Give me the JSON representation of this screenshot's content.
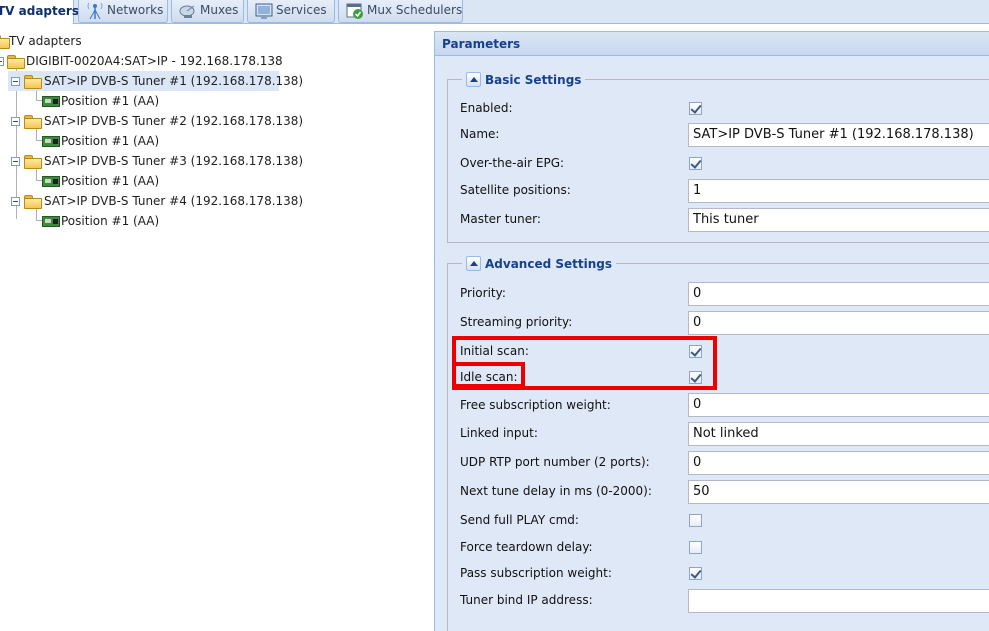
{
  "tabs": [
    {
      "label": "TV adapters",
      "icon": "tv-adapter-icon",
      "active": true
    },
    {
      "label": "Networks",
      "icon": "antenna-icon",
      "active": false
    },
    {
      "label": "Muxes",
      "icon": "dish-icon",
      "active": false
    },
    {
      "label": "Services",
      "icon": "tv-screen-icon",
      "active": false
    },
    {
      "label": "Mux Schedulers",
      "icon": "calendar-check-icon",
      "active": false
    }
  ],
  "tree": {
    "root": "TV adapters",
    "device": "DIGIBIT-0020A4:SAT>IP - 192.168.178.138",
    "tuners": [
      {
        "label": "SAT>IP DVB-S Tuner #1 (192.168.178.138)",
        "position": "Position #1 (AA)",
        "selected": true
      },
      {
        "label": "SAT>IP DVB-S Tuner #2 (192.168.178.138)",
        "position": "Position #1 (AA)",
        "selected": false
      },
      {
        "label": "SAT>IP DVB-S Tuner #3 (192.168.178.138)",
        "position": "Position #1 (AA)",
        "selected": false
      },
      {
        "label": "SAT>IP DVB-S Tuner #4 (192.168.178.138)",
        "position": "Position #1 (AA)",
        "selected": false
      }
    ]
  },
  "panel": {
    "title": "Parameters",
    "basic": {
      "legend": "Basic Settings",
      "enabled_label": "Enabled:",
      "enabled": true,
      "name_label": "Name:",
      "name_value": "SAT>IP DVB-S Tuner #1 (192.168.178.138)",
      "epg_label": "Over-the-air EPG:",
      "epg": true,
      "satpos_label": "Satellite positions:",
      "satpos_value": "1",
      "master_label": "Master tuner:",
      "master_value": "This tuner"
    },
    "advanced": {
      "legend": "Advanced Settings",
      "priority_label": "Priority:",
      "priority_value": "0",
      "stream_priority_label": "Streaming priority:",
      "stream_priority_value": "0",
      "initial_scan_label": "Initial scan:",
      "initial_scan": true,
      "idle_scan_label": "Idle scan:",
      "idle_scan": true,
      "free_weight_label": "Free subscription weight:",
      "free_weight_value": "0",
      "linked_label": "Linked input:",
      "linked_value": "Not linked",
      "udp_label": "UDP RTP port number (2 ports):",
      "udp_value": "0",
      "tune_delay_label": "Next tune delay in ms (0-2000):",
      "tune_delay_value": "50",
      "full_play_label": "Send full PLAY cmd:",
      "full_play": false,
      "teardown_label": "Force teardown delay:",
      "teardown": false,
      "pass_weight_label": "Pass subscription weight:",
      "pass_weight": true,
      "bind_ip_label": "Tuner bind IP address:",
      "bind_ip_value": ""
    }
  },
  "colors": {
    "highlight": "#ee0000",
    "panel_bg": "#dfe8f6",
    "header_text": "#15428b",
    "selection": "#dbe7f7"
  }
}
